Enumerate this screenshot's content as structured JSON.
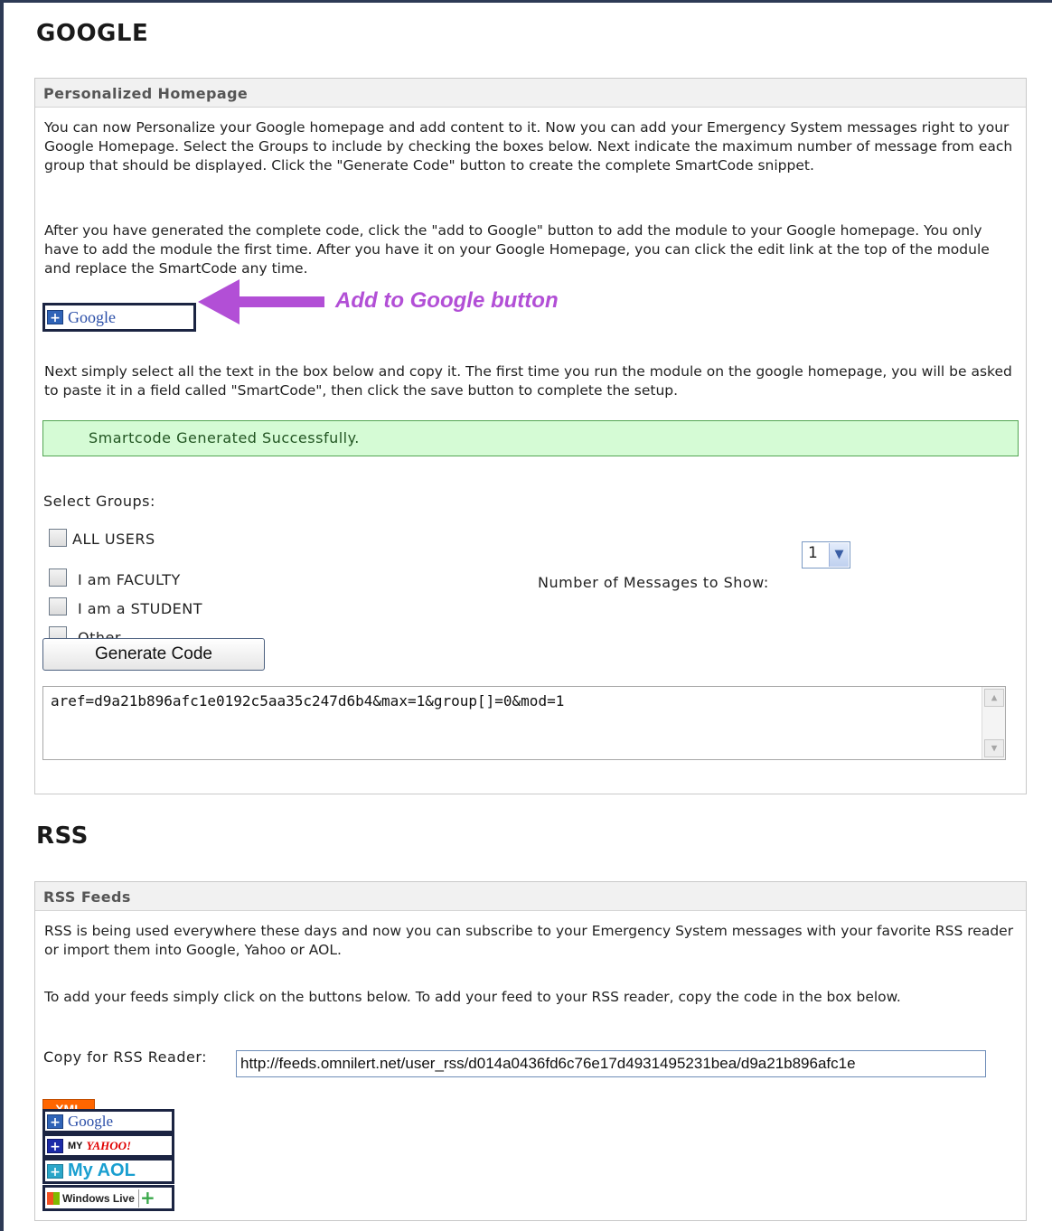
{
  "google": {
    "section_title": "GOOGLE",
    "panel_title": "Personalized Homepage",
    "intro_p1": "You can now Personalize your Google homepage and add content to it. Now you can add your Emergency System messages right to your Google Homepage. Select the Groups to include by checking the boxes below. Next indicate the maximum number of message from each group that should be displayed. Click the \"Generate Code\" button to create the complete SmartCode snippet.",
    "intro_p2": "After you have generated the complete code, click the \"add to Google\" button to add the module to your Google homepage. You only have to add the module the first time. After you have it on your Google Homepage, you can click the edit link at the top of the module and replace the SmartCode any time.",
    "add_button_label": "Google",
    "annotation": "Add to Google button",
    "annotation_color": "#b24fd6",
    "intro_p3": "Next simply select all the text in the box below and copy it. The first time you run the module on the google homepage, you will be asked to paste it in a field called \"SmartCode\", then click the save button to complete the setup.",
    "success_message": "Smartcode Generated Successfully.",
    "select_groups_label": "Select Groups:",
    "groups": [
      "ALL USERS",
      "I am FACULTY",
      "I am a STUDENT",
      "Other"
    ],
    "num_messages_label": "Number of Messages to Show:",
    "num_messages_value": "1",
    "generate_button": "Generate Code",
    "code_value": "aref=d9a21b896afc1e0192c5aa35c247d6b4&max=1&group[]=0&mod=1"
  },
  "rss": {
    "section_title": "RSS",
    "panel_title": "RSS Feeds",
    "p1": "RSS is being used everywhere these days and now you can subscribe to your Emergency System messages with your favorite RSS reader or import them into Google, Yahoo or AOL.",
    "p2": "To add your feeds simply click on the buttons below. To add your feed to your RSS reader, copy the code in the box below.",
    "copy_label": "Copy for RSS Reader:",
    "feed_url": "http://feeds.omnilert.net/user_rss/d014a0436fd6c76e17d4931495231bea/d9a21b896afc1e",
    "buttons": {
      "xml": "XML",
      "google": "Google",
      "yahoo_my": "MY",
      "yahoo": "YAHOO!",
      "aol": "My AOL",
      "windows_live": "Windows Live"
    }
  }
}
